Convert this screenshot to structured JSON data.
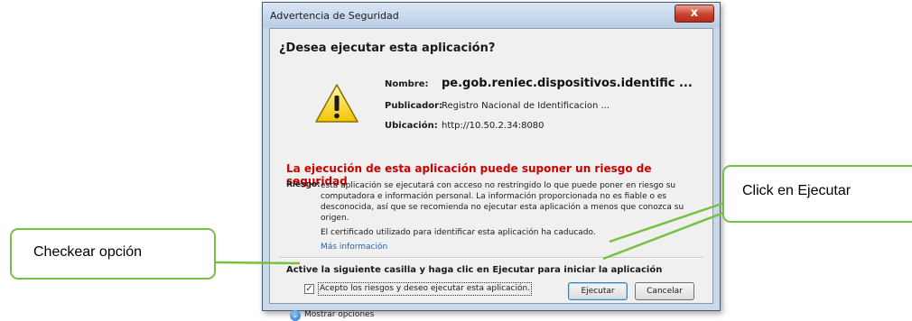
{
  "window": {
    "title": "Advertencia de Seguridad",
    "close_label": "x"
  },
  "dialog": {
    "heading": "¿Desea ejecutar esta aplicación?",
    "name_label": "Nombre:",
    "name_value": "pe.gob.reniec.dispositivos.identific ...",
    "publisher_label": "Publicador:",
    "publisher_value": "Registro Nacional de Identificacion ...",
    "location_label": "Ubicación:",
    "location_value": "http://10.50.2.34:8080",
    "risk_heading": "La ejecución de esta aplicación puede suponer un riesgo de seguridad",
    "risk_label": "Riesgo:",
    "risk_text": "esta aplicación se ejecutará con acceso no restringido lo que puede poner en riesgo su computadora e información personal. La información proporcionada no es fiable o es desconocida, así que se recomienda no ejecutar esta aplicación a menos que conozca su origen.",
    "certificate_text": "El certificado utilizado para identificar esta aplicación ha caducado.",
    "more_info_link": "Más información",
    "activate_text": "Active la siguiente casilla y haga clic en Ejecutar para iniciar la aplicación",
    "accept_checkbox_checked": true,
    "accept_label": "Acepto los riesgos y deseo ejecutar esta aplicación.",
    "run_button": "Ejecutar",
    "cancel_button": "Cancelar",
    "show_options": "Mostrar opciones"
  },
  "callouts": {
    "check_option": "Checkear opción",
    "click_run": "Click en Ejecutar"
  },
  "colors": {
    "risk_red": "#cc0000",
    "callout_border": "#77c043",
    "link_blue": "#1f62b7"
  },
  "icons": [
    "warning-icon",
    "close-icon",
    "checkmark-icon",
    "chevron-down-icon"
  ]
}
